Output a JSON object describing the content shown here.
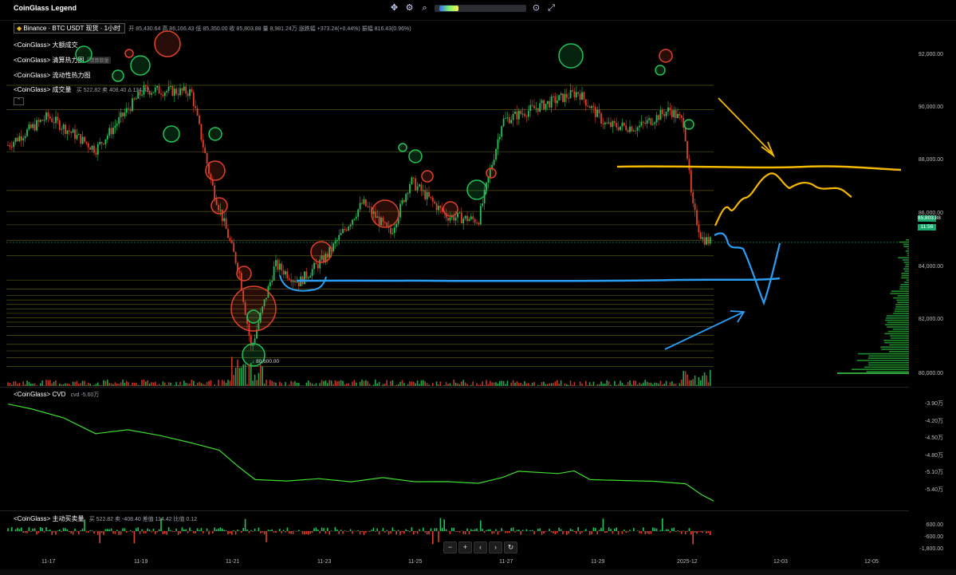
{
  "app": {
    "title": "CoinGlass Legend"
  },
  "toolbar": {
    "icons": [
      "crosshair-icon",
      "settings-icon",
      "search-icon",
      "camera-icon",
      "expand-icon"
    ],
    "zoom_level": 0.2
  },
  "symbol": {
    "name": "Binance · BTC USDT 现货 · 1小时",
    "open_label": "开",
    "open": "85,430.64",
    "high_label": "高",
    "high": "86,166.43",
    "low_label": "低",
    "low": "85,350.00",
    "close_label": "收",
    "close": "85,803.88",
    "volume_label": "量",
    "volume": "8,981.24万",
    "change_label": "涨跌幅",
    "change": "+373.24(+0.44%)",
    "amplitude_label": "振幅",
    "amplitude": "816.43(0.96%)"
  },
  "indicators": [
    {
      "label": "<CoinGlass> 大额成交"
    },
    {
      "label": "<CoinGlass> 清算热力图",
      "badge": "清算数量"
    },
    {
      "label": "<CoinGlass> 流动性热力图"
    },
    {
      "label": "<CoinGlass> 成交量",
      "buy_label": "买",
      "buy": "522.82",
      "sell_label": "卖",
      "sell": "408.40",
      "delta_label": "Δ",
      "delta": "114.42"
    }
  ],
  "price_axis": [
    "92,000.00",
    "90,000.00",
    "88,000.00",
    "86,000.00",
    "84,000.00",
    "82,000.00",
    "80,000.00"
  ],
  "current_price": {
    "value": "85,803.88",
    "countdown": "11:56"
  },
  "low_marker": "80,600.00",
  "cvd": {
    "title": "<CoinGlass> CVD",
    "label": "cvd",
    "value": "-5.60万",
    "axis": [
      "-3.90万",
      "-4.20万",
      "-4.50万",
      "-4.80万",
      "-5.10万",
      "-5.40万"
    ]
  },
  "taker": {
    "title": "<CoinGlass> 主动买卖量",
    "buy_label": "买",
    "buy": "522.82",
    "sell_label": "卖",
    "sell": "-408.40",
    "diff_label": "差值",
    "diff": "114.42",
    "ratio_label": "比值",
    "ratio": "0.12",
    "axis": [
      "600.00",
      "-600.00",
      "-1,800.00"
    ]
  },
  "dates": [
    "11-17",
    "11-19",
    "11-21",
    "11-23",
    "11-25",
    "11-27",
    "11-29",
    "2025-12",
    "12-03",
    "12-05"
  ],
  "controls": {
    "minus": "−",
    "plus": "+",
    "prev": "‹",
    "next": "›",
    "reset": "↻"
  },
  "colors": {
    "up": "#21c45a",
    "down": "#e0412b",
    "accent_yellow": "#f5b800",
    "accent_blue": "#2a9df4",
    "cvd": "#3ddc2e",
    "price_tag": "#18a86b"
  }
}
